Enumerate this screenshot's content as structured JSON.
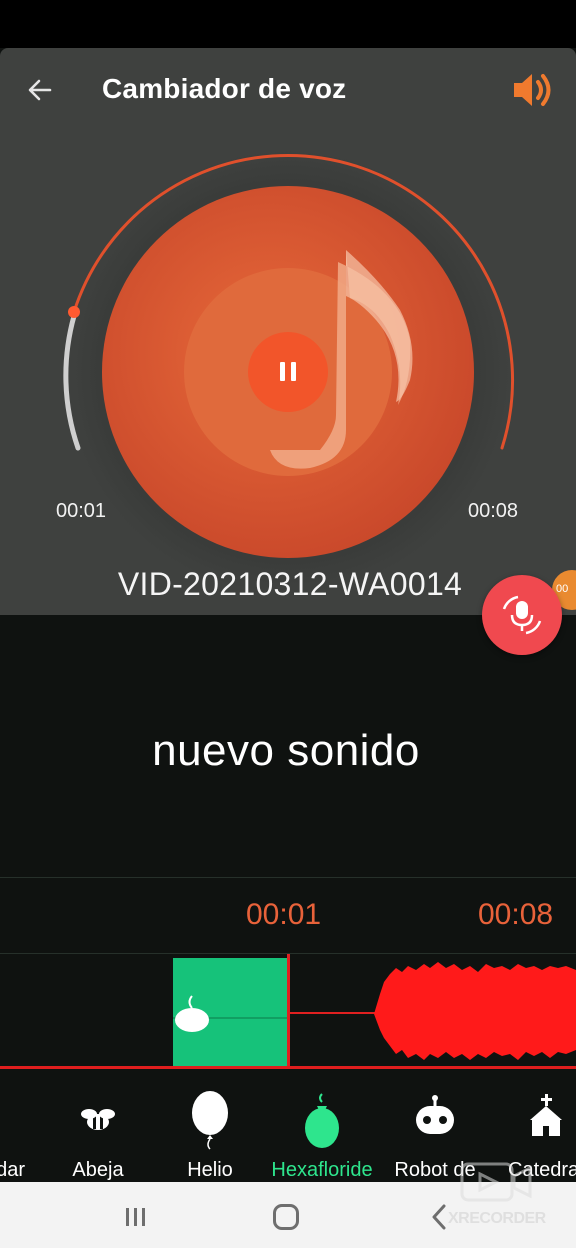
{
  "app": {
    "title": "Cambiador de voz"
  },
  "player": {
    "elapsed": "00:01",
    "duration": "00:08",
    "filename": "VID-20210312-WA0014",
    "progress_fraction": 0.125,
    "state": "playing"
  },
  "caption": "nuevo sonido",
  "timeline": {
    "time_start": "00:01",
    "time_end": "00:08"
  },
  "side_peek_label": "00",
  "effects": [
    {
      "label": "edar",
      "icon": "partial-icon"
    },
    {
      "label": "Abeja",
      "icon": "bee-icon"
    },
    {
      "label": "Helio",
      "icon": "balloon-icon"
    },
    {
      "label": "Hexafloride",
      "icon": "gas-balloon-icon",
      "active": true
    },
    {
      "label": "Robot de",
      "icon": "robot-icon"
    },
    {
      "label": "Catedra",
      "icon": "church-icon"
    }
  ],
  "watermark": "XRECORDER",
  "colors": {
    "accent": "#e8623a",
    "disc": "#d9532c",
    "active_effect": "#2ee58d",
    "selection": "#16c27a",
    "record_fab": "#f0494f",
    "waveform": "#ff1a1a"
  }
}
